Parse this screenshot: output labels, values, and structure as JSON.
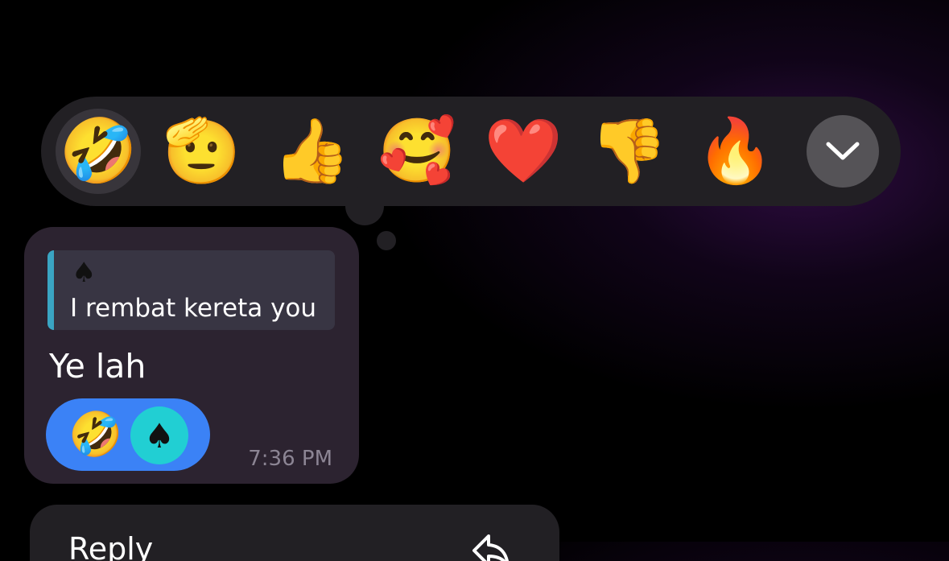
{
  "reaction_picker": {
    "reactions": [
      {
        "emoji": "🤣",
        "name": "rolling-on-the-floor-laughing",
        "selected": true
      },
      {
        "emoji": "🫡",
        "name": "saluting-face"
      },
      {
        "emoji": "👍",
        "name": "thumbs-up"
      },
      {
        "emoji": "🥰",
        "name": "smiling-face-with-hearts"
      },
      {
        "emoji": "❤️",
        "name": "red-heart"
      },
      {
        "emoji": "👎",
        "name": "thumbs-down"
      },
      {
        "emoji": "🔥",
        "name": "fire"
      }
    ],
    "expand_icon": "chevron-down-icon"
  },
  "message": {
    "reply": {
      "sender_icon": "♠",
      "text": "I rembat kereta you"
    },
    "text": "Ye lah",
    "reaction_pill": {
      "emoji": "🤣",
      "avatar_symbol": "♠"
    },
    "time": "7:36 PM"
  },
  "context_menu": {
    "first_item_label": "Reply",
    "first_item_icon": "reply-arrow-icon"
  },
  "colors": {
    "background": "#000000",
    "panel": "#222024",
    "message_bubble": "#2c2330",
    "reply_accent": "#3aa5c3",
    "reaction_pill": "#3b82f6",
    "avatar": "#21cfd3"
  }
}
